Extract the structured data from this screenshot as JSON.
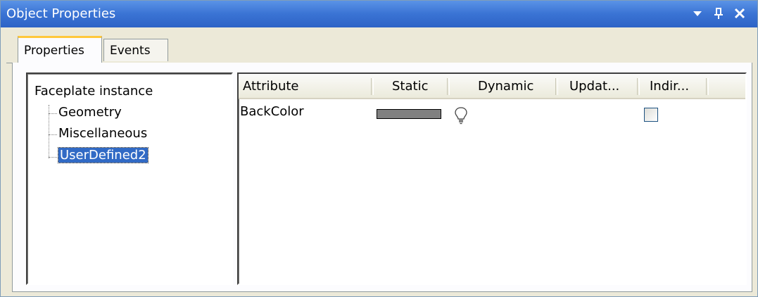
{
  "window": {
    "title": "Object Properties"
  },
  "titlebar_icons": {
    "dropdown": "dropdown-arrow-icon",
    "pin": "pin-icon",
    "close": "close-icon"
  },
  "tabs": [
    {
      "label": "Properties",
      "active": true
    },
    {
      "label": "Events",
      "active": false
    }
  ],
  "tree": {
    "root": "Faceplate instance",
    "children": [
      {
        "label": "Geometry",
        "selected": false
      },
      {
        "label": "Miscellaneous",
        "selected": false
      },
      {
        "label": "UserDefined2",
        "selected": true
      }
    ]
  },
  "grid": {
    "columns": [
      "Attribute",
      "Static",
      "Dynamic",
      "Updat...",
      "Indir..."
    ],
    "rows": [
      {
        "attribute": "BackColor",
        "static_color": "#808080",
        "dynamic_icon": "light-bulb-icon",
        "indirect_checked": false
      }
    ]
  },
  "colors": {
    "titlebar": "#3a73d4",
    "selection": "#316ac5",
    "tab_highlight": "#ffc83c"
  }
}
